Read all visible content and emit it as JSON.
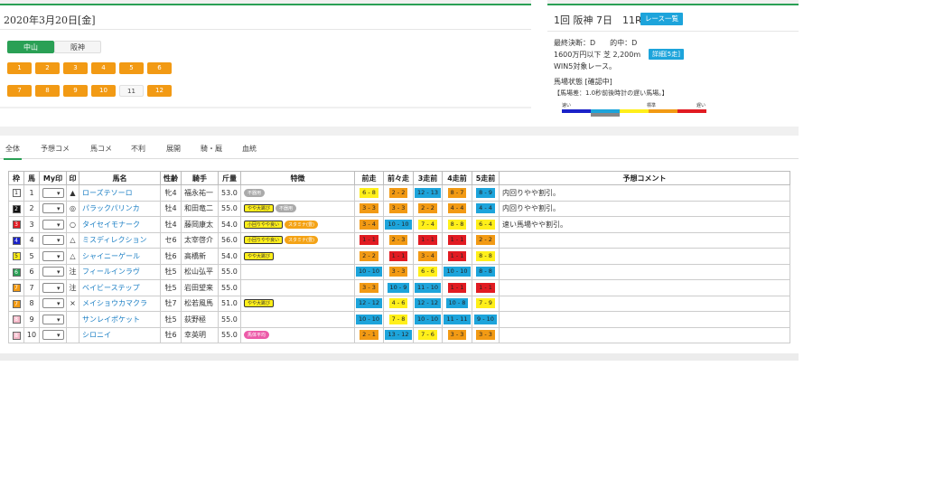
{
  "date_title": "2020年3月20日[金]",
  "venues": [
    {
      "label": "中山",
      "active": true
    },
    {
      "label": "阪神",
      "active": false
    }
  ],
  "race_buttons": [
    {
      "label": "1"
    },
    {
      "label": "2"
    },
    {
      "label": "3"
    },
    {
      "label": "4"
    },
    {
      "label": "5"
    },
    {
      "label": "6"
    },
    {
      "label": "7"
    },
    {
      "label": "8"
    },
    {
      "label": "9"
    },
    {
      "label": "10"
    },
    {
      "label": "11",
      "current": true
    },
    {
      "label": "12"
    }
  ],
  "race_header": {
    "title": "1回 阪神 7日　11R",
    "list_button": "レース一覧",
    "decision": "最終決断：D　　的中：D",
    "conditions": "1600万円以下 芝 2,200m",
    "detail_button": "詳細[5走]",
    "wins": "WIN5対象レース。",
    "track_status": "馬場状態 [確認中]",
    "track_note": "【馬場差：1.0秒前後時計の遅い馬場。】",
    "scale_fast": "速い",
    "scale_std": "標準",
    "scale_slow": "遅い",
    "scale_colors": [
      "#1a22c8",
      "#1da4db",
      "#ffef1a",
      "#f29a14",
      "#e11b22"
    ]
  },
  "tabs": [
    "全体",
    "予想コメ",
    "馬コメ",
    "不利",
    "展開",
    "騎・厩",
    "血統"
  ],
  "table": {
    "headers": [
      "枠",
      "馬",
      "My印",
      "印",
      "馬名",
      "性齢",
      "騎手",
      "斤量",
      "特徴",
      "前走",
      "前々走",
      "3走前",
      "4走前",
      "5走前",
      "予想コメント"
    ],
    "rows": [
      {
        "gate": "1",
        "gate_bg": "#ffffff",
        "gate_fg": "#222",
        "num": "1",
        "mark": "▲",
        "name": "ローズテソーロ",
        "sexage": "牝4",
        "jockey": "福永祐一",
        "weight": "53.0",
        "tags": [
          {
            "t": "不器用",
            "c": "gray"
          }
        ],
        "past": [
          {
            "v": "6 - 8",
            "c": "#ffef1a"
          },
          {
            "v": "2 - 2",
            "c": "#f29a14"
          },
          {
            "v": "12 - 13",
            "c": "#1da4db"
          },
          {
            "v": "8 - 7",
            "c": "#f29a14"
          },
          {
            "v": "8 - 9",
            "c": "#1da4db"
          }
        ],
        "comment": "内回りやや割引。"
      },
      {
        "gate": "2",
        "gate_bg": "#111111",
        "gate_fg": "#fff",
        "num": "2",
        "mark": "◎",
        "name": "パラックパリンカ",
        "sexage": "牡4",
        "jockey": "和田竜二",
        "weight": "55.0",
        "tags": [
          {
            "t": "やや大跳び",
            "c": "yellow"
          },
          {
            "t": "不器用",
            "c": "gray"
          }
        ],
        "past": [
          {
            "v": "3 - 3",
            "c": "#f29a14"
          },
          {
            "v": "3 - 3",
            "c": "#f29a14"
          },
          {
            "v": "2 - 2",
            "c": "#f29a14"
          },
          {
            "v": "4 - 4",
            "c": "#f29a14"
          },
          {
            "v": "4 - 4",
            "c": "#1da4db"
          }
        ],
        "comment": "内回りやや割引。"
      },
      {
        "gate": "3",
        "gate_bg": "#e11b22",
        "gate_fg": "#fff",
        "num": "3",
        "mark": "○",
        "name": "タイセイモナーク",
        "sexage": "牡4",
        "jockey": "藤岡康太",
        "weight": "54.0",
        "tags": [
          {
            "t": "小回りやや良い",
            "c": "yellow"
          },
          {
            "t": "スタミナ(豊)",
            "c": "orange"
          }
        ],
        "past": [
          {
            "v": "3 - 4",
            "c": "#f29a14"
          },
          {
            "v": "10 - 10",
            "c": "#1da4db"
          },
          {
            "v": "7 - 4",
            "c": "#ffef1a"
          },
          {
            "v": "8 - 8",
            "c": "#ffef1a"
          },
          {
            "v": "6 - 4",
            "c": "#ffef1a"
          }
        ],
        "comment": "速い馬場やや割引。"
      },
      {
        "gate": "4",
        "gate_bg": "#1a22c8",
        "gate_fg": "#fff",
        "num": "4",
        "mark": "△",
        "name": "ミスディレクション",
        "sexage": "セ6",
        "jockey": "太宰啓介",
        "weight": "56.0",
        "tags": [
          {
            "t": "小回りやや良い",
            "c": "yellow"
          },
          {
            "t": "スタミナ(豊)",
            "c": "orange"
          }
        ],
        "past": [
          {
            "v": "1 - 1",
            "c": "#e11b22"
          },
          {
            "v": "2 - 3",
            "c": "#f29a14"
          },
          {
            "v": "1 - 1",
            "c": "#e11b22"
          },
          {
            "v": "1 - 1",
            "c": "#e11b22"
          },
          {
            "v": "2 - 2",
            "c": "#f29a14"
          }
        ],
        "comment": ""
      },
      {
        "gate": "5",
        "gate_bg": "#ffef1a",
        "gate_fg": "#222",
        "num": "5",
        "mark": "△",
        "name": "シャイニーゲール",
        "sexage": "牡6",
        "jockey": "高橋新",
        "weight": "54.0",
        "tags": [
          {
            "t": "やや大跳び",
            "c": "yellow"
          }
        ],
        "past": [
          {
            "v": "2 - 2",
            "c": "#f29a14"
          },
          {
            "v": "1 - 1",
            "c": "#e11b22"
          },
          {
            "v": "3 - 4",
            "c": "#f29a14"
          },
          {
            "v": "1 - 1",
            "c": "#e11b22"
          },
          {
            "v": "8 - 8",
            "c": "#ffef1a"
          }
        ],
        "comment": ""
      },
      {
        "gate": "6",
        "gate_bg": "#2aa055",
        "gate_fg": "#fff",
        "num": "6",
        "mark": "注",
        "name": "フィールインラヴ",
        "sexage": "牡5",
        "jockey": "松山弘平",
        "weight": "55.0",
        "tags": [],
        "past": [
          {
            "v": "10 - 10",
            "c": "#1da4db"
          },
          {
            "v": "3 - 3",
            "c": "#f29a14"
          },
          {
            "v": "6 - 6",
            "c": "#ffef1a"
          },
          {
            "v": "10 - 10",
            "c": "#1da4db"
          },
          {
            "v": "8 - 8",
            "c": "#1da4db"
          }
        ],
        "comment": ""
      },
      {
        "gate": "7",
        "gate_bg": "#f29a14",
        "gate_fg": "#fff",
        "num": "7",
        "mark": "注",
        "name": "ベイビーステップ",
        "sexage": "牡5",
        "jockey": "岩田望来",
        "weight": "55.0",
        "tags": [],
        "past": [
          {
            "v": "3 - 3",
            "c": "#f29a14"
          },
          {
            "v": "10 - 9",
            "c": "#1da4db"
          },
          {
            "v": "11 - 10",
            "c": "#1da4db"
          },
          {
            "v": "1 - 1",
            "c": "#e11b22"
          },
          {
            "v": "1 - 1",
            "c": "#e11b22"
          }
        ],
        "comment": ""
      },
      {
        "gate": "7",
        "gate_bg": "#f29a14",
        "gate_fg": "#fff",
        "num": "8",
        "mark": "×",
        "name": "メイショウカマクラ",
        "sexage": "牡7",
        "jockey": "松若風馬",
        "weight": "51.0",
        "tags": [
          {
            "t": "やや大跳び",
            "c": "yellow"
          }
        ],
        "past": [
          {
            "v": "12 - 12",
            "c": "#1da4db"
          },
          {
            "v": "4 - 6",
            "c": "#ffef1a"
          },
          {
            "v": "12 - 12",
            "c": "#1da4db"
          },
          {
            "v": "10 - 8",
            "c": "#1da4db"
          },
          {
            "v": "7 - 9",
            "c": "#ffef1a"
          }
        ],
        "comment": ""
      },
      {
        "gate": "8",
        "gate_bg": "#f5b8c8",
        "gate_fg": "#fff",
        "num": "9",
        "mark": "",
        "name": "サンレイポケット",
        "sexage": "牡5",
        "jockey": "荻野極",
        "weight": "55.0",
        "tags": [],
        "past": [
          {
            "v": "10 - 10",
            "c": "#1da4db"
          },
          {
            "v": "7 - 8",
            "c": "#ffef1a"
          },
          {
            "v": "10 - 10",
            "c": "#1da4db"
          },
          {
            "v": "11 - 11",
            "c": "#1da4db"
          },
          {
            "v": "9 - 10",
            "c": "#1da4db"
          }
        ],
        "comment": ""
      },
      {
        "gate": "8",
        "gate_bg": "#f5b8c8",
        "gate_fg": "#fff",
        "num": "10",
        "mark": "",
        "name": "シロニイ",
        "sexage": "牡6",
        "jockey": "幸英明",
        "weight": "55.0",
        "tags": [
          {
            "t": "馬体平均",
            "c": "pink"
          }
        ],
        "past": [
          {
            "v": "2 - 1",
            "c": "#f29a14"
          },
          {
            "v": "13 - 12",
            "c": "#1da4db"
          },
          {
            "v": "7 - 6",
            "c": "#ffef1a"
          },
          {
            "v": "3 - 3",
            "c": "#f29a14"
          },
          {
            "v": "3 - 3",
            "c": "#f29a14"
          }
        ],
        "comment": ""
      }
    ]
  }
}
